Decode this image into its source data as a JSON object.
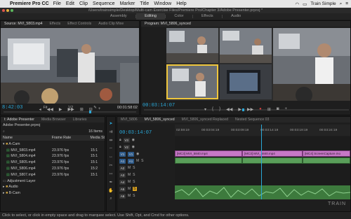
{
  "menubar": {
    "app": "Premiere Pro CC",
    "items": [
      "File",
      "Edit",
      "Clip",
      "Sequence",
      "Marker",
      "Title",
      "Window",
      "Help"
    ],
    "right_label": "Train Simple"
  },
  "titlebar": {
    "path": "/Users/trainsimple/Desktop/Multi-cam Exercise Files/Premiere Pro/Chapter 3/Adobe Presenter.prproj *"
  },
  "workspaces": [
    "Assembly",
    "Editing",
    "Color",
    "Effects",
    "Audio"
  ],
  "source": {
    "tabs": [
      "Source: MVI_5803.mp4",
      "Effects",
      "Effect Controls",
      "Audio Clip Mixe"
    ],
    "timecode_in": "8:42:03",
    "fit": "Fit",
    "resolution": "1/2",
    "timecode_dur": "00:01:58:02"
  },
  "program": {
    "tab": "Program: MVI_5806_synced",
    "timecode": "00:03:14:07"
  },
  "project": {
    "tabs": [
      "t: Adobe Presenter",
      "Media Browser",
      "Libraries"
    ],
    "file": "Adobe Presenter.prproj",
    "count": "16 Items",
    "columns": [
      "Name",
      "Frame Rate",
      "Media St"
    ],
    "rows": [
      {
        "name": "A-Cam",
        "rate": "",
        "media": "",
        "type": "bin"
      },
      {
        "name": "MVI_5803.mp4",
        "rate": "23.976 fps",
        "media": "15:1",
        "type": "clip"
      },
      {
        "name": "MVI_5804.mp4",
        "rate": "23.976 fps",
        "media": "15:1",
        "type": "clip"
      },
      {
        "name": "MVI_5805.mp4",
        "rate": "23.976 fps",
        "media": "15:1",
        "type": "clip"
      },
      {
        "name": "MVI_5806.mp4",
        "rate": "23.976 fps",
        "media": "15:2",
        "type": "clip"
      },
      {
        "name": "MVI_5807.mp4",
        "rate": "23.976 fps",
        "media": "15:1",
        "type": "clip"
      },
      {
        "name": "Adjustment Layer",
        "rate": "",
        "media": "",
        "type": "item"
      },
      {
        "name": "Audio",
        "rate": "",
        "media": "",
        "type": "bin"
      },
      {
        "name": "B-Cam",
        "rate": "",
        "media": "",
        "type": "bin"
      }
    ]
  },
  "timeline": {
    "tabs": [
      "MVI_5806",
      "MVI_5806_synced",
      "MVI_5806_synced Replaced",
      "Nested Sequence 03"
    ],
    "timecode": "00:03:14:07",
    "ruler": [
      "02:59:19",
      "00:03:04:19",
      "00:03:09:19",
      "00:03:14:19",
      "00:03:19:19",
      "00:03:24:19"
    ],
    "video_tracks": [
      "V3",
      "V2",
      "V1"
    ],
    "audio_tracks": [
      "A1",
      "A2",
      "A3",
      "A4",
      "A5",
      "A6"
    ],
    "clips": [
      {
        "label": "[MC3] MVI_5840.mp4"
      },
      {
        "label": "[MC3] MVI_5840.mp4"
      },
      {
        "label": "[MC4] ScreenCapture.mo"
      }
    ]
  },
  "status": {
    "text": "Click to select, or click in empty space and drag to marquee select. Use Shift, Opt, and Cmd for other options."
  },
  "watermark": "TRAIN"
}
